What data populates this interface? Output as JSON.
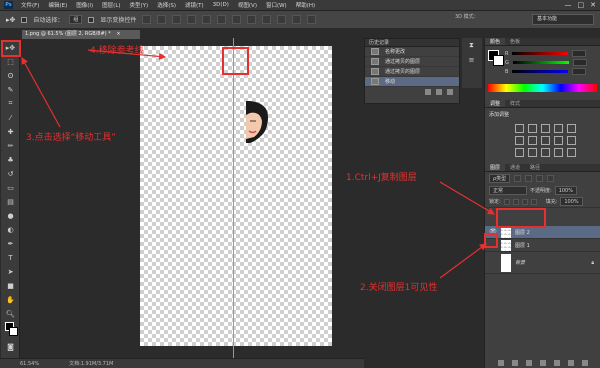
{
  "menubar": {
    "logo": "Ps",
    "items": [
      "文件(F)",
      "编辑(E)",
      "图像(I)",
      "图层(L)",
      "类型(Y)",
      "选择(S)",
      "滤镜(T)",
      "3D(D)",
      "视图(V)",
      "窗口(W)",
      "帮助(H)"
    ],
    "window_controls": [
      "—",
      "□",
      "✕"
    ]
  },
  "options": {
    "auto_select_label": "自动选择：",
    "auto_select_value": "组",
    "show_transform_label": "显示变换控件",
    "mode_3d_label": "3D 模式：",
    "workspace": "基本功能"
  },
  "document": {
    "tab_title": "1.png @ 61.5% (图层 2, RGB/8#) *",
    "tab_close": "×"
  },
  "status": {
    "zoom": "61.54%",
    "doc_info": "文档:1.91M/3.71M"
  },
  "history": {
    "title": "历史记录",
    "items": [
      "名称更改",
      "通过拷贝的图层",
      "通过拷贝的图层",
      "移动"
    ]
  },
  "color": {
    "tabs": [
      "颜色",
      "色板"
    ],
    "channels": [
      "R",
      "G",
      "B"
    ],
    "channel_colors": [
      "#d33",
      "#3b3",
      "#33d"
    ]
  },
  "adjustments": {
    "tabs": [
      "调整",
      "样式"
    ],
    "add_label": "添加调整"
  },
  "layers": {
    "tabs": [
      "图层",
      "通道",
      "路径"
    ],
    "filter_label": "ρ类型",
    "blend_mode": "正常",
    "opacity_label": "不透明度:",
    "opacity_value": "100%",
    "lock_label": "锁定:",
    "fill_label": "填充:",
    "fill_value": "100%",
    "rows": [
      {
        "name": "图层 2",
        "visible": true,
        "selected": true
      },
      {
        "name": "图层 1",
        "visible": false,
        "selected": false
      },
      {
        "name": "背景",
        "visible": false,
        "selected": false
      }
    ]
  },
  "annotations": {
    "step1": "1.Ctrl+J复制图层",
    "step2": "2.关闭图层1可见性",
    "step3": "3.点击选择“移动工具”",
    "step4": "4.移除参考线",
    "color": "#e53030"
  },
  "tools": [
    "move-tool",
    "marquee-tool",
    "lasso-tool",
    "quick-select-tool",
    "crop-tool",
    "eyedropper-tool",
    "healing-tool",
    "brush-tool",
    "clone-tool",
    "history-brush-tool",
    "eraser-tool",
    "gradient-tool",
    "blur-tool",
    "dodge-tool",
    "pen-tool",
    "type-tool",
    "path-select-tool",
    "shape-tool",
    "hand-tool",
    "zoom-tool"
  ]
}
